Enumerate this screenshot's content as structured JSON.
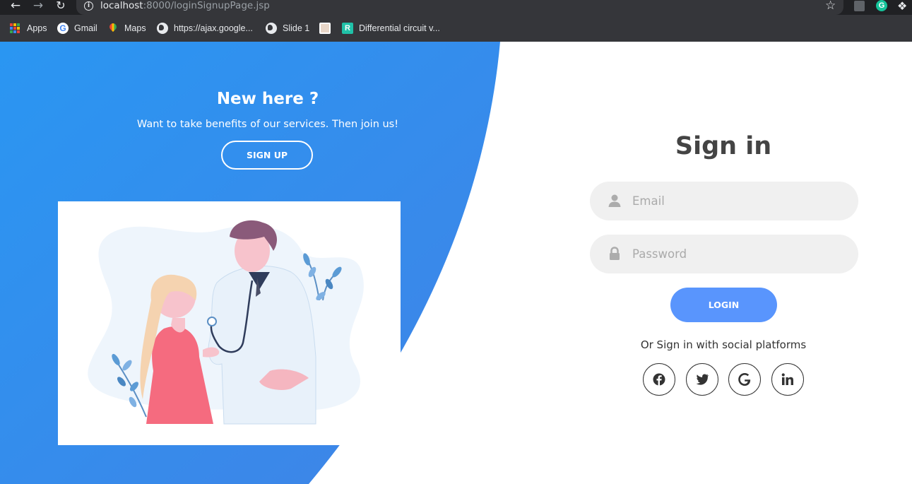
{
  "browser": {
    "url_host": "localhost",
    "url_path": ":8000/loginSignupPage.jsp",
    "bookmarks": [
      {
        "label": "Apps",
        "icon": "apps-grid-icon"
      },
      {
        "label": "Gmail",
        "icon": "google-icon"
      },
      {
        "label": "Maps",
        "icon": "maps-pin-icon"
      },
      {
        "label": "https://ajax.google...",
        "icon": "globe-icon"
      },
      {
        "label": "Slide 1",
        "icon": "globe-icon"
      },
      {
        "label": "",
        "icon": "image-favicon-icon"
      },
      {
        "label": "Differential circuit v...",
        "icon": "r-favicon-icon"
      }
    ]
  },
  "left_panel": {
    "title": "New here ?",
    "subtitle": "Want to take benefits of our services. Then join us!",
    "signup_label": "SIGN UP",
    "illustration": "doctor-patient-illustration"
  },
  "signin": {
    "title": "Sign in",
    "email_placeholder": "Email",
    "password_placeholder": "Password",
    "login_label": "LOGIN",
    "social_text": "Or Sign in with social platforms",
    "social": [
      {
        "name": "facebook",
        "icon": "facebook-icon"
      },
      {
        "name": "twitter",
        "icon": "twitter-icon"
      },
      {
        "name": "google",
        "icon": "google-icon"
      },
      {
        "name": "linkedin",
        "icon": "linkedin-icon"
      }
    ]
  },
  "colors": {
    "accent": "#5995fd",
    "panel_blue_start": "#2a93f0",
    "panel_blue_end": "#3f85e8",
    "chrome_dark": "#202124",
    "chrome_bar": "#35363a"
  }
}
